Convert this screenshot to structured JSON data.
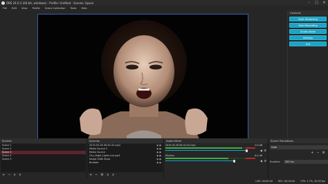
{
  "window": {
    "title": "OBS 24.0.3 (64-bit, windows) - Profile: Untitled - Scenes: Space",
    "controls": [
      "–",
      "□",
      "✕"
    ]
  },
  "menu": [
    "File",
    "Edit",
    "View",
    "Profile",
    "Scene Collection",
    "Tools",
    "Help"
  ],
  "controls_dock": {
    "title": "Controls",
    "buttons": [
      "Start Streaming",
      "Start Recording",
      "Studio Mode",
      "Settings",
      "Exit"
    ]
  },
  "scenes": {
    "title": "Scenes",
    "items": [
      "Scene 1",
      "Scene 2",
      "Scene 3",
      "Scene 4",
      "Scene 5"
    ],
    "selected_index": 2
  },
  "sources": {
    "title": "Sources",
    "items": [
      "2019-05-28 08-45-42.mp4",
      "Media Source 2",
      "Media Source",
      "City_Night_Lights Ind.mp3",
      "Image Slide Show",
      "Browser"
    ]
  },
  "audio_mixer": {
    "title": "Audio Mixer",
    "tracks": [
      {
        "name": "2019-05-28 08-45-42.mp4",
        "db": "0.0 dB",
        "level": 0.85
      },
      {
        "name": "Mic/Aux",
        "db": "-6.4 dB",
        "level": 0.7
      }
    ]
  },
  "transitions": {
    "title": "Scene Transitions",
    "selected": "Fade",
    "duration_label": "Duration",
    "duration_value": "300 ms"
  },
  "status": {
    "live": "LIVE: 00:00:00",
    "rec": "REC: 00:00:00",
    "cpu": "CPU: 1.7%, 30.00 fps"
  },
  "colors": {
    "accent": "#1ea3c4",
    "selection": "#5d2430",
    "canvas_border": "#3c5fa6"
  }
}
